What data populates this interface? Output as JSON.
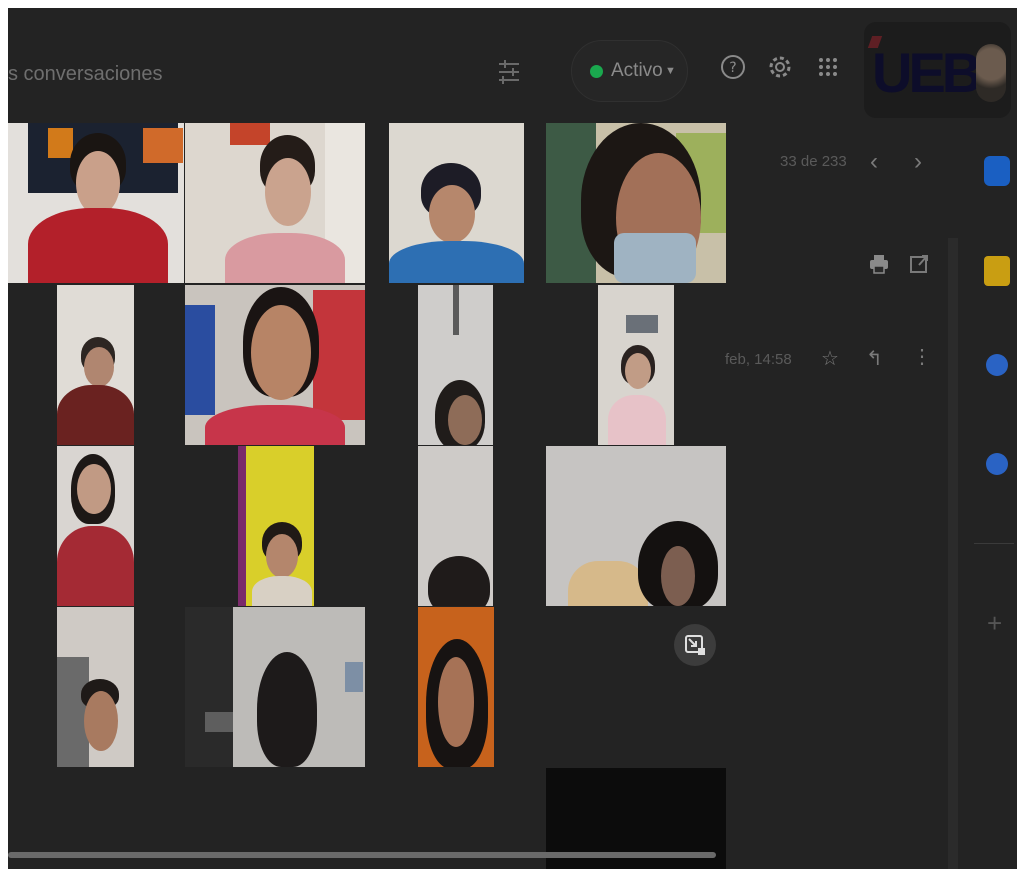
{
  "search": {
    "placeholder_text": "s conversaciones"
  },
  "status": {
    "label": "Activo",
    "color": "#1aa84e"
  },
  "brand": {
    "logo": "UEB"
  },
  "mail": {
    "count": "33 de 233",
    "date": "feb, 14:58"
  },
  "icons": [
    "tune-icon",
    "help-icon",
    "settings-icon",
    "apps-icon",
    "chevron-left-icon",
    "chevron-right-icon",
    "print-icon",
    "open-new-window-icon",
    "star-icon",
    "reply-icon",
    "more-vert-icon",
    "calendar-icon",
    "keep-icon",
    "tasks-icon",
    "contacts-icon",
    "add-icon",
    "minimize-icon"
  ],
  "side_apps": [
    {
      "name": "calendar",
      "color": "#1a5fc2"
    },
    {
      "name": "keep",
      "color": "#c99e12"
    },
    {
      "name": "tasks",
      "color": "#2a63c4"
    },
    {
      "name": "contacts",
      "color": "#2a63c4"
    }
  ],
  "participants_count": 15
}
